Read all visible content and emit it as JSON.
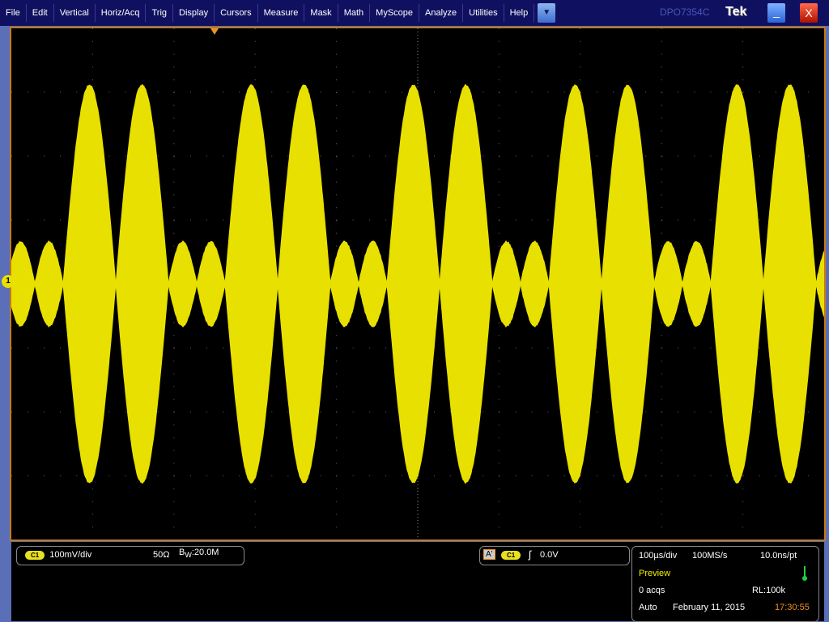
{
  "menu": [
    "File",
    "Edit",
    "Vertical",
    "Horiz/Acq",
    "Trig",
    "Display",
    "Cursors",
    "Measure",
    "Mask",
    "Math",
    "MyScope",
    "Analyze",
    "Utilities",
    "Help"
  ],
  "menu_dropdown_icon": "triangle-down",
  "model": "DPO7354C",
  "brand": "Tek",
  "minimize_label": "_",
  "close_label": "X",
  "channel": {
    "badge": "C1",
    "scale": "100mV/div",
    "impedance": "50Ω",
    "bw_prefix": "B",
    "bw_sub": "W",
    "bw_value": ":20.0M",
    "marker": "1"
  },
  "trigger": {
    "mode_badge": "A'",
    "source": "C1",
    "slope_icon": "rising-edge",
    "level": "0.0V"
  },
  "acq": {
    "timebase": "100µs/div",
    "sample_rate": "100MS/s",
    "resolution": "10.0ns/pt",
    "state": "Preview",
    "acqs": "0 acqs",
    "record_length": "RL:100k",
    "trigger_mode": "Auto",
    "date": "February 11, 2015",
    "time": "17:30:55"
  },
  "colors": {
    "trace": "#e8e000",
    "graticule_border": "#c87a10",
    "menu_bg": "#101060",
    "preview": "#f0f000",
    "time": "#f09020",
    "run_indicator": "#20d040"
  },
  "waveform": {
    "large_amplitude_div": 3.1,
    "small_amplitude_div": 0.65,
    "envelope_period": "200µs"
  }
}
